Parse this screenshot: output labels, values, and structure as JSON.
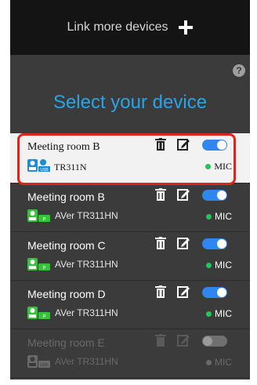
{
  "header": {
    "link_label": "Link more devices"
  },
  "help_icon_text": "?",
  "title": "Select your device",
  "colors": {
    "accent": "#2aa4e6",
    "toggle_on": "#2f86f0",
    "mic_active": "#21c65a",
    "highlight": "#e0241c"
  },
  "devices": [
    {
      "name": "Meeting room B",
      "model": "TR311N",
      "mic": "MIC",
      "enabled": true,
      "selected": true,
      "icon": "usb-camera-icon"
    },
    {
      "name": "Meeting room B",
      "model": "AVer TR311HN",
      "mic": "MIC",
      "enabled": true,
      "selected": false,
      "icon": "ip-camera-icon"
    },
    {
      "name": "Meeting room C",
      "model": "AVer TR311HN",
      "mic": "MIC",
      "enabled": true,
      "selected": false,
      "icon": "ip-camera-icon"
    },
    {
      "name": "Meeting room D",
      "model": "AVer TR311HN",
      "mic": "MIC",
      "enabled": true,
      "selected": false,
      "icon": "ip-camera-icon"
    },
    {
      "name": "Meeting room E",
      "model": "AVer TR311HN",
      "mic": "MIC",
      "enabled": false,
      "selected": false,
      "icon": "usb-camera-icon"
    }
  ]
}
